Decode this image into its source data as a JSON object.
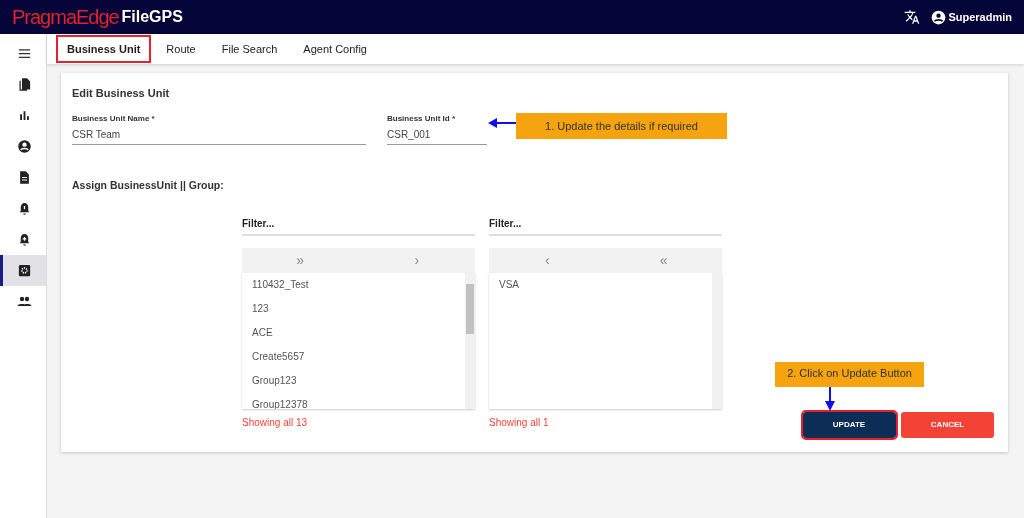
{
  "header": {
    "brand_primary": "PragmaEdge",
    "brand_secondary": "FileGPS",
    "user": "Superadmin"
  },
  "sidebar": {
    "items": [
      {
        "kind": "menu",
        "selected": false
      },
      {
        "kind": "files",
        "selected": false
      },
      {
        "kind": "chart",
        "selected": false
      },
      {
        "kind": "account",
        "selected": false
      },
      {
        "kind": "document",
        "selected": false
      },
      {
        "kind": "alert",
        "selected": false
      },
      {
        "kind": "alert-add",
        "selected": false
      },
      {
        "kind": "settings",
        "selected": true
      },
      {
        "kind": "people",
        "selected": false
      }
    ]
  },
  "tabs": [
    {
      "label": "Business Unit",
      "selected": true,
      "highlighted": true
    },
    {
      "label": "Route",
      "selected": false,
      "highlighted": false
    },
    {
      "label": "File Search",
      "selected": false,
      "highlighted": false
    },
    {
      "label": "Agent Config",
      "selected": false,
      "highlighted": false
    }
  ],
  "form": {
    "title": "Edit Business Unit",
    "fields": [
      {
        "label": "Business Unit Name *",
        "value": "CSR Team"
      },
      {
        "label": "Business Unit Id *",
        "value": "CSR_001"
      }
    ],
    "assign_label": "Assign BusinessUnit || Group:"
  },
  "available": {
    "placeholder": "Filter...",
    "controls": [
      "»",
      "›"
    ],
    "items": [
      "110432_Test",
      "123",
      "ACE",
      "Create5657",
      "Group123",
      "Group12378"
    ],
    "count": "Showing all 13"
  },
  "selected_list": {
    "placeholder": "Filter...",
    "controls": [
      "‹",
      "«"
    ],
    "items": [
      "VSA"
    ],
    "count": "Showing all 1"
  },
  "buttons": [
    {
      "label": "UPDATE",
      "kind": "primary",
      "highlighted": true
    },
    {
      "label": "CANCEL",
      "kind": "danger",
      "highlighted": false
    }
  ],
  "callouts": [
    {
      "text": "1. Update the details if required"
    },
    {
      "text": "2. Click on Update Button"
    }
  ]
}
